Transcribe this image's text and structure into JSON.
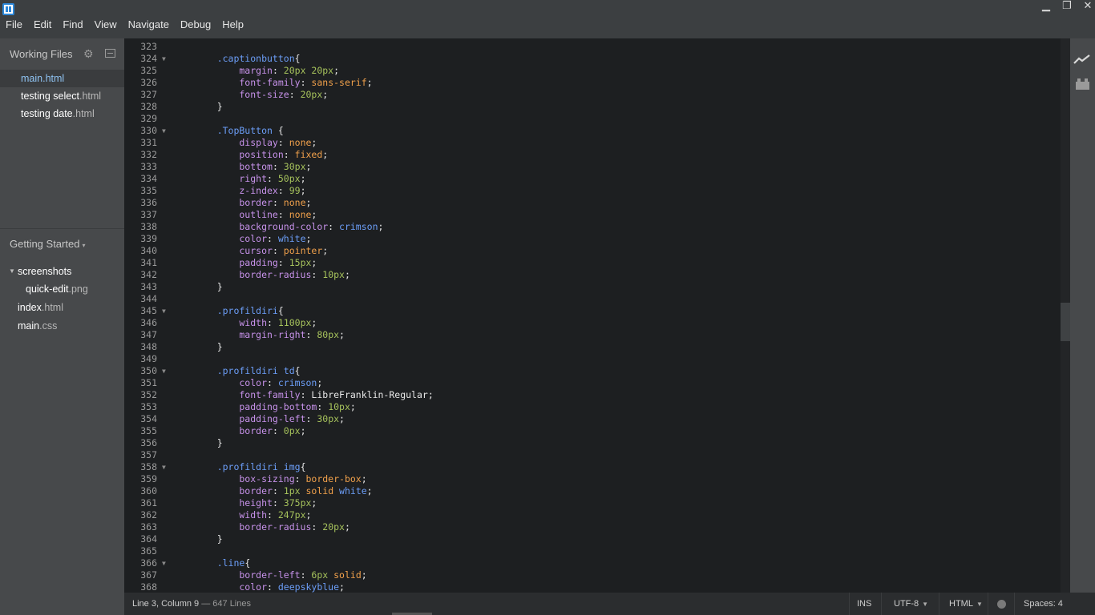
{
  "titlebar": {
    "logo_icon": "brackets-logo-icon",
    "window_controls": {
      "minimize": "▁",
      "maximize": "❐",
      "close": "✕"
    }
  },
  "menu": [
    "File",
    "Edit",
    "Find",
    "View",
    "Navigate",
    "Debug",
    "Help"
  ],
  "sidebar": {
    "working_files": {
      "title": "Working Files",
      "items": [
        {
          "name": "main",
          "ext": ".html",
          "active": true
        },
        {
          "name": "testing select",
          "ext": ".html",
          "active": false
        },
        {
          "name": "testing date",
          "ext": ".html",
          "active": false
        }
      ]
    },
    "project": {
      "title": "Getting Started",
      "caret": "▾",
      "tree": [
        {
          "name": "screenshots",
          "ext": "",
          "type": "folder",
          "expanded": true
        },
        {
          "name": "quick-edit",
          "ext": ".png",
          "type": "file"
        },
        {
          "name": "index",
          "ext": ".html",
          "type": "file"
        },
        {
          "name": "main",
          "ext": ".css",
          "type": "file"
        }
      ]
    }
  },
  "editor": {
    "lines": [
      {
        "n": "323",
        "fold": false,
        "tokens": []
      },
      {
        "n": "324",
        "fold": true,
        "tokens": [
          [
            "sel",
            "    .captionbutton"
          ],
          [
            "pun",
            "{"
          ]
        ]
      },
      {
        "n": "325",
        "fold": false,
        "tokens": [
          [
            "prop",
            "        margin"
          ],
          [
            "pun",
            ": "
          ],
          [
            "num",
            "20px 20px"
          ],
          [
            "pun",
            ";"
          ]
        ]
      },
      {
        "n": "326",
        "fold": false,
        "tokens": [
          [
            "prop",
            "        font-family"
          ],
          [
            "pun",
            ": "
          ],
          [
            "val",
            "sans-serif"
          ],
          [
            "pun",
            ";"
          ]
        ]
      },
      {
        "n": "327",
        "fold": false,
        "tokens": [
          [
            "prop",
            "        font-size"
          ],
          [
            "pun",
            ": "
          ],
          [
            "num",
            "20px"
          ],
          [
            "pun",
            ";"
          ]
        ]
      },
      {
        "n": "328",
        "fold": false,
        "tokens": [
          [
            "pun",
            "    }"
          ]
        ]
      },
      {
        "n": "329",
        "fold": false,
        "tokens": []
      },
      {
        "n": "330",
        "fold": true,
        "tokens": [
          [
            "sel",
            "    .TopButton "
          ],
          [
            "pun",
            "{"
          ]
        ]
      },
      {
        "n": "331",
        "fold": false,
        "tokens": [
          [
            "prop",
            "        display"
          ],
          [
            "pun",
            ": "
          ],
          [
            "val",
            "none"
          ],
          [
            "pun",
            ";"
          ]
        ]
      },
      {
        "n": "332",
        "fold": false,
        "tokens": [
          [
            "prop",
            "        position"
          ],
          [
            "pun",
            ": "
          ],
          [
            "val",
            "fixed"
          ],
          [
            "pun",
            ";"
          ]
        ]
      },
      {
        "n": "333",
        "fold": false,
        "tokens": [
          [
            "prop",
            "        bottom"
          ],
          [
            "pun",
            ": "
          ],
          [
            "num",
            "30px"
          ],
          [
            "pun",
            ";"
          ]
        ]
      },
      {
        "n": "334",
        "fold": false,
        "tokens": [
          [
            "prop",
            "        right"
          ],
          [
            "pun",
            ": "
          ],
          [
            "num",
            "50px"
          ],
          [
            "pun",
            ";"
          ]
        ]
      },
      {
        "n": "335",
        "fold": false,
        "tokens": [
          [
            "prop",
            "        z-index"
          ],
          [
            "pun",
            ": "
          ],
          [
            "num",
            "99"
          ],
          [
            "pun",
            ";"
          ]
        ]
      },
      {
        "n": "336",
        "fold": false,
        "tokens": [
          [
            "prop",
            "        border"
          ],
          [
            "pun",
            ": "
          ],
          [
            "val",
            "none"
          ],
          [
            "pun",
            ";"
          ]
        ]
      },
      {
        "n": "337",
        "fold": false,
        "tokens": [
          [
            "prop",
            "        outline"
          ],
          [
            "pun",
            ": "
          ],
          [
            "val",
            "none"
          ],
          [
            "pun",
            ";"
          ]
        ]
      },
      {
        "n": "338",
        "fold": false,
        "tokens": [
          [
            "prop",
            "        background-color"
          ],
          [
            "pun",
            ": "
          ],
          [
            "col",
            "crimson"
          ],
          [
            "pun",
            ";"
          ]
        ]
      },
      {
        "n": "339",
        "fold": false,
        "tokens": [
          [
            "prop",
            "        color"
          ],
          [
            "pun",
            ": "
          ],
          [
            "col",
            "white"
          ],
          [
            "pun",
            ";"
          ]
        ]
      },
      {
        "n": "340",
        "fold": false,
        "tokens": [
          [
            "prop",
            "        cursor"
          ],
          [
            "pun",
            ": "
          ],
          [
            "val",
            "pointer"
          ],
          [
            "pun",
            ";"
          ]
        ]
      },
      {
        "n": "341",
        "fold": false,
        "tokens": [
          [
            "prop",
            "        padding"
          ],
          [
            "pun",
            ": "
          ],
          [
            "num",
            "15px"
          ],
          [
            "pun",
            ";"
          ]
        ]
      },
      {
        "n": "342",
        "fold": false,
        "tokens": [
          [
            "prop",
            "        border-radius"
          ],
          [
            "pun",
            ": "
          ],
          [
            "num",
            "10px"
          ],
          [
            "pun",
            ";"
          ]
        ]
      },
      {
        "n": "343",
        "fold": false,
        "tokens": [
          [
            "pun",
            "    }"
          ]
        ]
      },
      {
        "n": "344",
        "fold": false,
        "tokens": []
      },
      {
        "n": "345",
        "fold": true,
        "tokens": [
          [
            "sel",
            "    .profildiri"
          ],
          [
            "pun",
            "{"
          ]
        ]
      },
      {
        "n": "346",
        "fold": false,
        "tokens": [
          [
            "prop",
            "        width"
          ],
          [
            "pun",
            ": "
          ],
          [
            "num",
            "1100px"
          ],
          [
            "pun",
            ";"
          ]
        ]
      },
      {
        "n": "347",
        "fold": false,
        "tokens": [
          [
            "prop",
            "        margin-right"
          ],
          [
            "pun",
            ": "
          ],
          [
            "num",
            "80px"
          ],
          [
            "pun",
            ";"
          ]
        ]
      },
      {
        "n": "348",
        "fold": false,
        "tokens": [
          [
            "pun",
            "    }"
          ]
        ]
      },
      {
        "n": "349",
        "fold": false,
        "tokens": []
      },
      {
        "n": "350",
        "fold": true,
        "tokens": [
          [
            "sel",
            "    .profildiri td"
          ],
          [
            "pun",
            "{"
          ]
        ]
      },
      {
        "n": "351",
        "fold": false,
        "tokens": [
          [
            "prop",
            "        color"
          ],
          [
            "pun",
            ": "
          ],
          [
            "col",
            "crimson"
          ],
          [
            "pun",
            ";"
          ]
        ]
      },
      {
        "n": "352",
        "fold": false,
        "tokens": [
          [
            "prop",
            "        font-family"
          ],
          [
            "pun",
            ": "
          ],
          [
            "pun",
            "LibreFranklin-Regular"
          ],
          [
            "pun",
            ";"
          ]
        ]
      },
      {
        "n": "353",
        "fold": false,
        "tokens": [
          [
            "prop",
            "        padding-bottom"
          ],
          [
            "pun",
            ": "
          ],
          [
            "num",
            "10px"
          ],
          [
            "pun",
            ";"
          ]
        ]
      },
      {
        "n": "354",
        "fold": false,
        "tokens": [
          [
            "prop",
            "        padding-left"
          ],
          [
            "pun",
            ": "
          ],
          [
            "num",
            "30px"
          ],
          [
            "pun",
            ";"
          ]
        ]
      },
      {
        "n": "355",
        "fold": false,
        "tokens": [
          [
            "prop",
            "        border"
          ],
          [
            "pun",
            ": "
          ],
          [
            "num",
            "0px"
          ],
          [
            "pun",
            ";"
          ]
        ]
      },
      {
        "n": "356",
        "fold": false,
        "tokens": [
          [
            "pun",
            "    }"
          ]
        ]
      },
      {
        "n": "357",
        "fold": false,
        "tokens": []
      },
      {
        "n": "358",
        "fold": true,
        "tokens": [
          [
            "sel",
            "    .profildiri img"
          ],
          [
            "pun",
            "{"
          ]
        ]
      },
      {
        "n": "359",
        "fold": false,
        "tokens": [
          [
            "prop",
            "        box-sizing"
          ],
          [
            "pun",
            ": "
          ],
          [
            "val",
            "border-box"
          ],
          [
            "pun",
            ";"
          ]
        ]
      },
      {
        "n": "360",
        "fold": false,
        "tokens": [
          [
            "prop",
            "        border"
          ],
          [
            "pun",
            ": "
          ],
          [
            "num",
            "1px "
          ],
          [
            "val",
            "solid "
          ],
          [
            "col",
            "white"
          ],
          [
            "pun",
            ";"
          ]
        ]
      },
      {
        "n": "361",
        "fold": false,
        "tokens": [
          [
            "prop",
            "        height"
          ],
          [
            "pun",
            ": "
          ],
          [
            "num",
            "375px"
          ],
          [
            "pun",
            ";"
          ]
        ]
      },
      {
        "n": "362",
        "fold": false,
        "tokens": [
          [
            "prop",
            "        width"
          ],
          [
            "pun",
            ": "
          ],
          [
            "num",
            "247px"
          ],
          [
            "pun",
            ";"
          ]
        ]
      },
      {
        "n": "363",
        "fold": false,
        "tokens": [
          [
            "prop",
            "        border-radius"
          ],
          [
            "pun",
            ": "
          ],
          [
            "num",
            "20px"
          ],
          [
            "pun",
            ";"
          ]
        ]
      },
      {
        "n": "364",
        "fold": false,
        "tokens": [
          [
            "pun",
            "    }"
          ]
        ]
      },
      {
        "n": "365",
        "fold": false,
        "tokens": []
      },
      {
        "n": "366",
        "fold": true,
        "tokens": [
          [
            "sel",
            "    .line"
          ],
          [
            "pun",
            "{"
          ]
        ]
      },
      {
        "n": "367",
        "fold": false,
        "tokens": [
          [
            "prop",
            "        border-left"
          ],
          [
            "pun",
            ": "
          ],
          [
            "num",
            "6px "
          ],
          [
            "val",
            "solid"
          ],
          [
            "pun",
            ";"
          ]
        ]
      },
      {
        "n": "368",
        "fold": false,
        "tokens": [
          [
            "prop",
            "        color"
          ],
          [
            "pun",
            ": "
          ],
          [
            "col",
            "deepskyblue"
          ],
          [
            "pun",
            ";"
          ]
        ]
      }
    ]
  },
  "right_toolbar": {
    "live_preview_icon": "live-preview-icon",
    "extension_manager_icon": "extension-manager-icon"
  },
  "statusbar": {
    "cursor": "Line 3, Column 9",
    "lines_sub": " — 647 Lines",
    "mode": "INS",
    "encoding": "UTF-8",
    "language": "HTML",
    "spaces_label": "Spaces: 4"
  }
}
